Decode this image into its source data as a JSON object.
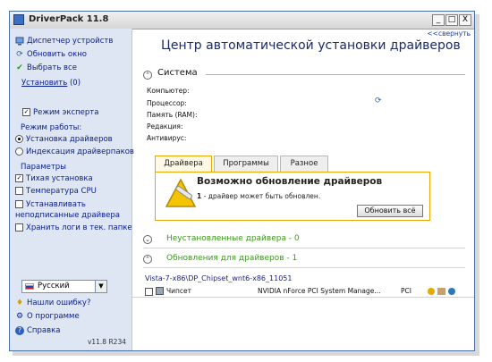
{
  "window": {
    "title": "DriverPack 11.8",
    "controls": {
      "minimize": "_",
      "maximize": "□",
      "close": "X"
    }
  },
  "sidebar": {
    "device_manager": "Диспетчер устройств",
    "refresh_window": "Обновить окно",
    "select_all": "Выбрать все",
    "install": "Установить",
    "install_count": "(0)",
    "expert_mode": "Режим эксперта",
    "expert_mode_checked": true,
    "work_mode_label": "Режим работы:",
    "mode_install": "Установка драйверов",
    "mode_index": "Индексация драйверпаков",
    "mode_selected": "install",
    "params_label": "Параметры",
    "silent_install": "Тихая установка",
    "silent_install_checked": true,
    "cpu_temp": "Температура CPU",
    "cpu_temp_checked": false,
    "unsigned_line1": "Устанавливать",
    "unsigned_line2": "неподписанные драйвера",
    "unsigned_checked": false,
    "keep_logs": "Хранить логи в тек. папке",
    "keep_logs_checked": false,
    "language": "Русский",
    "found_error": "Нашли ошибку?",
    "about": "О программе",
    "help": "Справка",
    "version": "v11.8 R234"
  },
  "main": {
    "collapse_link": "<<свернуть",
    "title": "Центр автоматической установки драйверов",
    "system_section": "Система",
    "system_props": {
      "computer": "Компьютер:",
      "processor": "Процессор:",
      "memory": "Память (RAM):",
      "edition": "Редакция:",
      "antivirus": "Антивирус:"
    },
    "tabs": [
      "Драйвера",
      "Программы",
      "Разное"
    ],
    "active_tab": 0,
    "panel": {
      "title": "Возможно обновление драйверов",
      "count": "1",
      "subtitle": " - драйвер может быть обновлен.",
      "button": "Обновить всё"
    },
    "not_installed": "Неустановленные драйвера -  0",
    "updates": "Обновления для драйверов -  1",
    "driver_path": "Vista-7-x86\\DP_Chipset_wnt6-x86_11051",
    "driver_row": {
      "category": "Чипсет",
      "device": "NVIDIA nForce PCI System Manage...",
      "bus": "PCI"
    }
  },
  "colors": {
    "sidebar_bg": "#dde6f2",
    "link_blue": "#0a1c8c",
    "section_green": "#3a9a1a",
    "tab_accent": "#e8a800"
  }
}
